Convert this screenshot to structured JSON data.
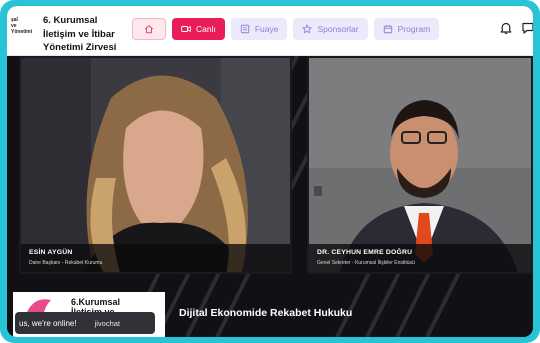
{
  "header": {
    "mini_logo_lines": [
      "şal",
      "ve",
      "Yönetimi"
    ],
    "title_lines": [
      "6. Kurumsal",
      "İletişim ve İtibar",
      "Yönetimi Zirvesi"
    ]
  },
  "nav": {
    "items": [
      {
        "id": "home",
        "label": "",
        "icon": "home-icon"
      },
      {
        "id": "live",
        "label": "Canlı",
        "icon": "video-camera-icon"
      },
      {
        "id": "foyer",
        "label": "Fuaye",
        "icon": "foyer-icon"
      },
      {
        "id": "sponsors",
        "label": "Sponsorlar",
        "icon": "star-icon"
      },
      {
        "id": "program",
        "label": "Program",
        "icon": "calendar-icon"
      }
    ]
  },
  "header_icons": [
    "bell-icon",
    "chat-bubble-icon"
  ],
  "speakers": [
    {
      "name": "ESİN AYGÜN",
      "role": "Daire Başkanı - Rekabet Kurumu"
    },
    {
      "name": "DR. CEYHUN EMRE DOĞRU",
      "role": "Genel Sekreter - Kurumsal İlişkiler Enstitüsü"
    }
  ],
  "banner": {
    "logo_lines": [
      "6.Kurumsal",
      "İletişim ve"
    ],
    "session_title": "Dijital Ekonomide Rekabet Hukuku"
  },
  "chat_widget": {
    "text": "us, we're online!",
    "brand": "jivochat"
  },
  "colors": {
    "frame": "#27c3d6",
    "live_button": "#e91e57",
    "nav_button": "#ede9fb",
    "nav_text": "#8a80d8"
  }
}
